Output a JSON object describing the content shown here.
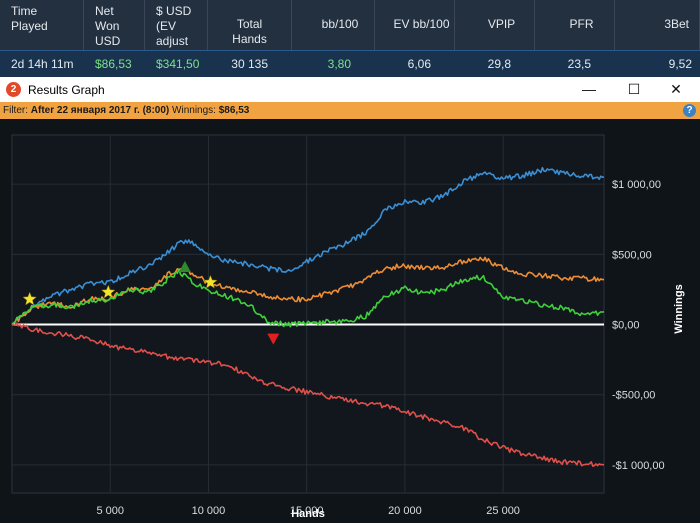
{
  "stats": {
    "headers": [
      "Time\nPlayed",
      "Net\nWon\nUSD",
      "$ USD\n(EV\nadjust",
      "Total\nHands",
      "bb/100",
      "EV bb/100",
      "VPIP",
      "PFR",
      "3Bet"
    ],
    "values": [
      "2d 14h 11m",
      "$86,53",
      "$341,50",
      "30 135",
      "3,80",
      "6,06",
      "29,8",
      "23,5",
      "9,52"
    ],
    "value_colors": [
      "#e4e9ef",
      "#7de08a",
      "#7de08a",
      "#e4e9ef",
      "#7de08a",
      "#e4e9ef",
      "#e4e9ef",
      "#e4e9ef",
      "#e4e9ef"
    ]
  },
  "window": {
    "title": "Results Graph",
    "app_icon": "app-logo-icon",
    "minimize": "—",
    "maximize": "☐",
    "close": "✕",
    "help": "?"
  },
  "filter": {
    "label": "Filter:",
    "value": "After 22 января 2017 г. (8:00)",
    "winnings_label": "Winnings:",
    "winnings_value": "$86,53"
  },
  "chart_data": {
    "type": "line",
    "xlabel": "Hands",
    "ylabel": "Winnings",
    "xlim": [
      0,
      30135
    ],
    "ylim": [
      -1200,
      1350
    ],
    "xticks": [
      5000,
      10000,
      15000,
      20000,
      25000
    ],
    "xtick_labels": [
      "5 000",
      "10 000",
      "15 000",
      "20 000",
      "25 000"
    ],
    "yticks": [
      1000,
      500,
      0,
      -500,
      -1000
    ],
    "ytick_labels": [
      "$1 000,00",
      "$500,00",
      "$0,00",
      "-$500,00",
      "-$1 000,00"
    ],
    "grid": true,
    "legend": "none",
    "series": [
      {
        "color": "#3a8fd4",
        "x": [
          0,
          1000,
          2000,
          3000,
          4000,
          5000,
          6000,
          7000,
          8000,
          8500,
          9000,
          10000,
          11000,
          12000,
          13000,
          14000,
          15000,
          16000,
          17000,
          18000,
          19000,
          20000,
          21000,
          22000,
          23000,
          24000,
          25000,
          26000,
          27000,
          28000,
          29000,
          30135
        ],
        "y": [
          0,
          120,
          200,
          250,
          290,
          300,
          370,
          420,
          520,
          580,
          600,
          500,
          450,
          430,
          400,
          380,
          450,
          520,
          580,
          650,
          820,
          880,
          870,
          920,
          1020,
          1080,
          1040,
          1060,
          1100,
          1080,
          1060,
          1050
        ]
      },
      {
        "color": "#ef8d35",
        "x": [
          0,
          1000,
          2000,
          3000,
          4000,
          5000,
          6000,
          7000,
          8000,
          8500,
          9000,
          10000,
          11000,
          12000,
          13000,
          14000,
          15000,
          16000,
          17000,
          18000,
          19000,
          20000,
          21000,
          22000,
          23000,
          24000,
          25000,
          26000,
          27000,
          28000,
          29000,
          30135
        ],
        "y": [
          0,
          120,
          150,
          130,
          180,
          190,
          250,
          260,
          360,
          400,
          380,
          300,
          260,
          240,
          200,
          180,
          180,
          220,
          260,
          320,
          400,
          420,
          400,
          410,
          450,
          470,
          400,
          360,
          350,
          330,
          330,
          320
        ]
      },
      {
        "color": "#3fd13a",
        "x": [
          0,
          1000,
          2000,
          3000,
          4000,
          5000,
          6000,
          7000,
          8000,
          8500,
          9000,
          10000,
          11000,
          12000,
          13000,
          14000,
          15000,
          16000,
          17000,
          18000,
          19000,
          20000,
          21000,
          22000,
          23000,
          24000,
          25000,
          26000,
          27000,
          28000,
          29000,
          30135
        ],
        "y": [
          0,
          130,
          140,
          120,
          170,
          180,
          250,
          230,
          330,
          380,
          320,
          240,
          200,
          150,
          20,
          0,
          10,
          20,
          20,
          60,
          200,
          260,
          220,
          250,
          320,
          340,
          200,
          170,
          140,
          120,
          70,
          90
        ]
      },
      {
        "color": "#e0504a",
        "x": [
          0,
          1000,
          2000,
          3000,
          4000,
          5000,
          6000,
          7000,
          8000,
          9000,
          10000,
          11000,
          12000,
          13000,
          14000,
          15000,
          16000,
          17000,
          18000,
          19000,
          20000,
          21000,
          22000,
          23000,
          24000,
          25000,
          26000,
          27000,
          28000,
          29000,
          30135
        ],
        "y": [
          0,
          -30,
          -60,
          -80,
          -110,
          -150,
          -180,
          -200,
          -230,
          -250,
          -270,
          -290,
          -360,
          -420,
          -450,
          -480,
          -510,
          -540,
          -560,
          -580,
          -620,
          -660,
          -700,
          -740,
          -820,
          -880,
          -920,
          -950,
          -980,
          -990,
          -1000
        ]
      }
    ],
    "markers": [
      {
        "shape": "star",
        "color": "#f5e42c",
        "x": 900,
        "y": 180
      },
      {
        "shape": "star",
        "color": "#f5e42c",
        "x": 4900,
        "y": 230
      },
      {
        "shape": "star",
        "color": "#f5e42c",
        "x": 10100,
        "y": 300
      },
      {
        "shape": "triangle-up",
        "color": "#2f8a2f",
        "x": 8800,
        "y": 410
      },
      {
        "shape": "triangle-down",
        "color": "#e02020",
        "x": 13300,
        "y": -100
      }
    ]
  }
}
